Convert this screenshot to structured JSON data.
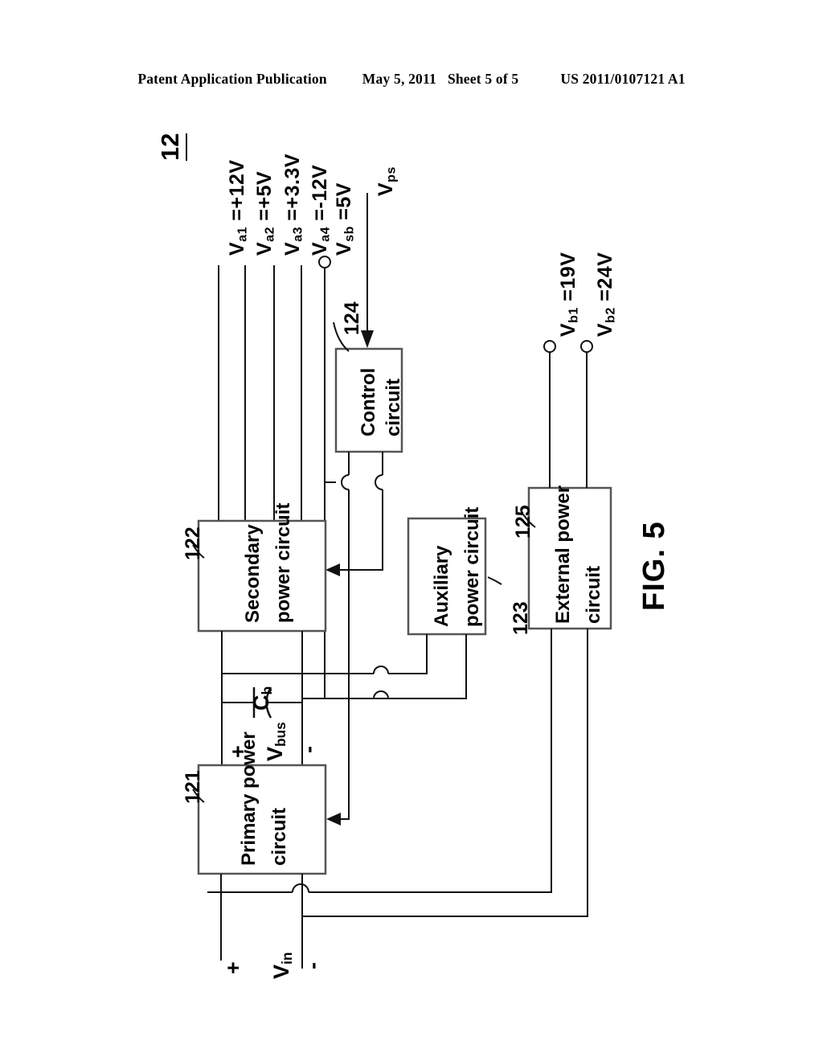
{
  "header": {
    "publication": "Patent Application Publication",
    "date": "May 5, 2011",
    "sheet": "Sheet 5 of 5",
    "patent_number": "US 2011/0107121 A1"
  },
  "figure": {
    "title": "FIG. 5",
    "assembly_ref": "12"
  },
  "blocks": [
    {
      "ref": "121",
      "line1": "Primary power",
      "line2": "circuit"
    },
    {
      "ref": "122",
      "line1": "Secondary",
      "line2": "power circuit"
    },
    {
      "ref": "123",
      "line1": "Auxiliary",
      "line2": "power circuit"
    },
    {
      "ref": "124",
      "line1": "Control",
      "line2": "circuit"
    },
    {
      "ref": "125",
      "line1": "External power",
      "line2": "circuit"
    }
  ],
  "outputs": {
    "secondary": [
      {
        "name": "Va1",
        "sub": "a1",
        "base": "V",
        "value": "=+12V",
        "full": "Va1 =+12V"
      },
      {
        "name": "Va2",
        "sub": "a2",
        "base": "V",
        "value": "=+5V",
        "full": "Va2 =+5V"
      },
      {
        "name": "Va3",
        "sub": "a3",
        "base": "V",
        "value": "=+3.3V",
        "full": "Va3 =+3.3V"
      },
      {
        "name": "Va4",
        "sub": "a4",
        "base": "V",
        "value": "=-12V",
        "full": "Va4 =-12V"
      }
    ],
    "standby": {
      "sub": "sb",
      "base": "V",
      "value": "=5V",
      "full": "Vsb =5V"
    },
    "external": [
      {
        "sub": "b1",
        "base": "V",
        "value": "=19V",
        "full": "Vb1 =19V"
      },
      {
        "sub": "b2",
        "base": "V",
        "value": "=24V",
        "full": "Vb2 =24V"
      }
    ]
  },
  "signals": {
    "ps": {
      "base": "V",
      "sub": "ps",
      "full": "Vps"
    },
    "bus": {
      "base": "V",
      "sub": "bus",
      "full": "Vbus"
    },
    "in": {
      "base": "V",
      "sub": "in",
      "full": "Vin"
    }
  },
  "components": {
    "bus_capacitor": {
      "base": "C",
      "sub": "b",
      "full": "Cb"
    }
  },
  "polarity": {
    "bus_plus": "+",
    "bus_minus": "-",
    "in_plus": "+",
    "in_minus": "-"
  },
  "colors": {
    "ink": "#000000",
    "paper": "#ffffff",
    "wire": "#1a1a1a",
    "box_stroke": "#555555"
  }
}
